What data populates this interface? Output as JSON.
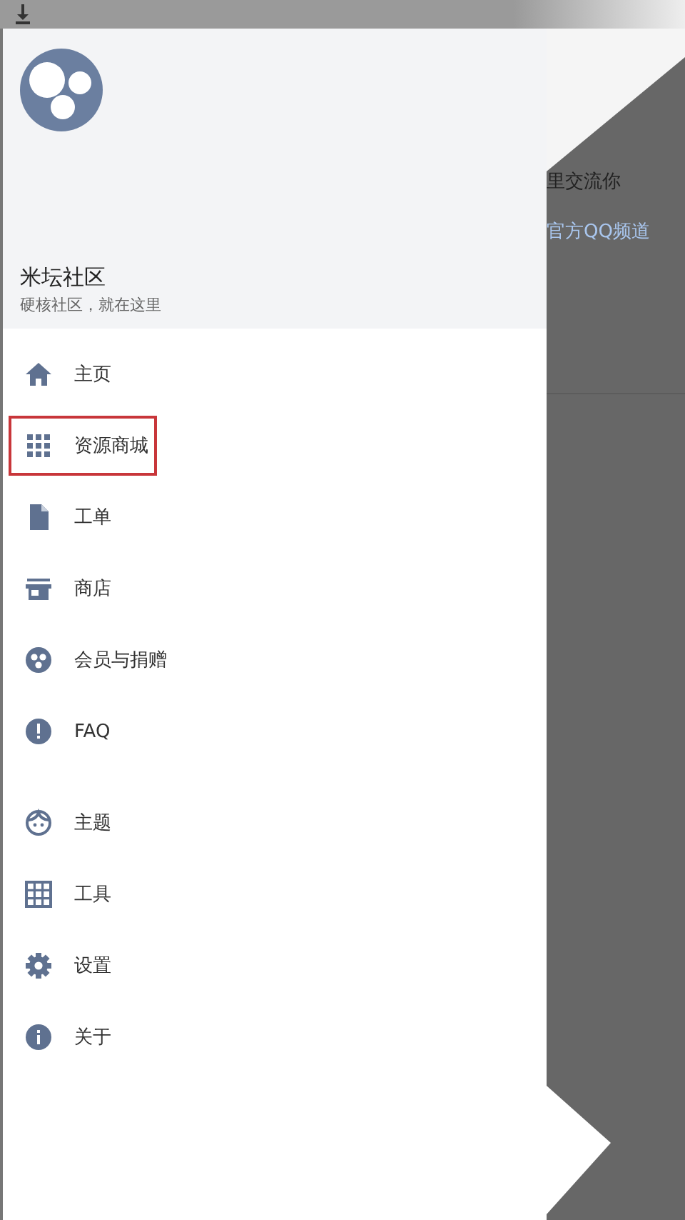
{
  "drawer": {
    "title": "米坛社区",
    "subtitle": "硬核社区，就在这里",
    "groups": [
      [
        {
          "kind": "home",
          "label": "主页",
          "highlighted": false
        },
        {
          "kind": "apps",
          "label": "资源商城",
          "highlighted": true
        },
        {
          "kind": "file",
          "label": "工单",
          "highlighted": false
        },
        {
          "kind": "store",
          "label": "商店",
          "highlighted": false
        },
        {
          "kind": "circles",
          "label": "会员与捐赠",
          "highlighted": false
        },
        {
          "kind": "alert",
          "label": "FAQ",
          "highlighted": false
        }
      ],
      [
        {
          "kind": "face",
          "label": "主题",
          "highlighted": false
        },
        {
          "kind": "grid",
          "label": "工具",
          "highlighted": false
        },
        {
          "kind": "gear",
          "label": "设置",
          "highlighted": false
        },
        {
          "kind": "info",
          "label": "关于",
          "highlighted": false
        }
      ]
    ]
  },
  "background": {
    "text": "里交流你",
    "link": "官方QQ频道"
  }
}
